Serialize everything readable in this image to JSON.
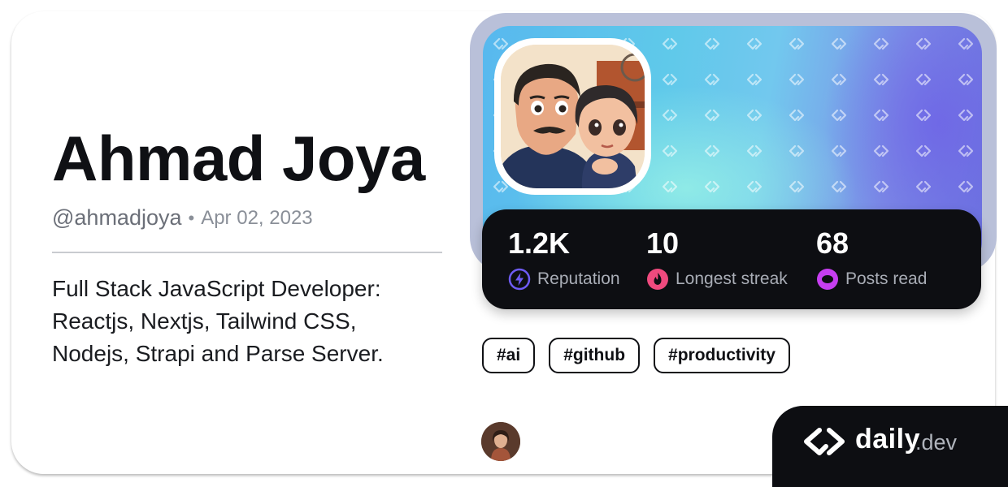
{
  "profile": {
    "name": "Ahmad Joya",
    "handle": "@ahmadjoya",
    "separator": "•",
    "joined_date": "Apr 02, 2023",
    "bio": "Full Stack JavaScript Developer: Reactjs, Nextjs, Tailwind CSS, Nodejs, Strapi and Parse Server."
  },
  "stats": [
    {
      "value": "1.2K",
      "label": "Reputation",
      "icon": "lightning-icon",
      "color": "#6e5bf5"
    },
    {
      "value": "10",
      "label": "Longest streak",
      "icon": "flame-icon",
      "color": "#ef4a7e"
    },
    {
      "value": "68",
      "label": "Posts read",
      "icon": "posts-read-icon",
      "color": "#c63ef0"
    }
  ],
  "tags": [
    "#ai",
    "#github",
    "#productivity"
  ],
  "brand": {
    "daily": "daily",
    "dev": ".dev"
  },
  "colors": {
    "text_dark": "#0f1014",
    "stats_background": "#0d0e12",
    "cover_frame": "#b9c0d9"
  }
}
